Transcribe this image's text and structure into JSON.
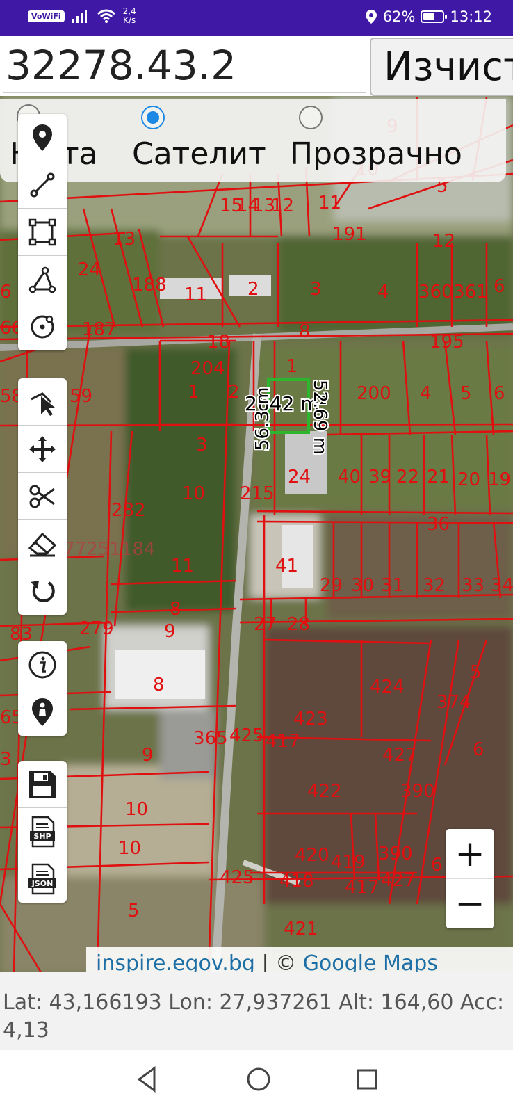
{
  "status_bar": {
    "vowifi": "VoWiFi",
    "speed_value": "2,4",
    "speed_unit": "K/s",
    "battery": "62%",
    "battery_level": 0.62,
    "time": "13:12"
  },
  "search": {
    "value": "32278.43.2"
  },
  "clear_button": {
    "label": "Изчист"
  },
  "map_type": {
    "options": [
      {
        "label": "Карта",
        "visible_text": "Н    ота",
        "selected": false
      },
      {
        "label": "Сателит",
        "selected": true
      },
      {
        "label": "Прозрачно",
        "selected": false
      }
    ]
  },
  "map": {
    "selected_parcel_area": "2642 m²",
    "edge_length_1": "56.3 m",
    "edge_length_2": "52.69 m",
    "watermark_phone": "0877251184",
    "parcel_labels": [
      "13",
      "24",
      "188",
      "11",
      "2",
      "3",
      "4",
      "360",
      "361",
      "191",
      "12",
      "14",
      "13",
      "12",
      "11",
      "15",
      "9",
      "10",
      "5",
      "187",
      "167",
      "8",
      "18",
      "195",
      "204",
      "1",
      "2",
      "200",
      "4",
      "5",
      "6",
      "58",
      "59",
      "3",
      "24",
      "40",
      "39",
      "22",
      "21",
      "20",
      "19",
      "36",
      "10",
      "215",
      "282",
      "41",
      "29",
      "30",
      "31",
      "32",
      "33",
      "34",
      "11",
      "8",
      "9",
      "83",
      "279",
      "27",
      "28",
      "8",
      "424",
      "374",
      "5",
      "423",
      "365",
      "425",
      "417",
      "6",
      "9",
      "422",
      "390",
      "10",
      "10",
      "425",
      "420",
      "419",
      "390",
      "418",
      "417",
      "427",
      "6",
      "5",
      "421",
      "66",
      "6",
      "3",
      "65"
    ]
  },
  "tools": {
    "group1": [
      "marker-icon",
      "line-icon",
      "polygon-icon",
      "path-angle-icon",
      "circle-icon"
    ],
    "group2": [
      "select-icon",
      "move-icon",
      "cut-icon",
      "eraser-icon",
      "undo-icon"
    ],
    "group3": [
      "info-icon",
      "my-location-icon"
    ],
    "group4": [
      "save-icon",
      "shp-icon",
      "json-icon"
    ],
    "shp_text": "SHP",
    "json_text": "JSON"
  },
  "zoom": {
    "plus": "+",
    "minus": "−"
  },
  "attribution": {
    "source1": "inspire.egov.bg",
    "separator": "| ©",
    "source2": "Google Maps"
  },
  "coordinates": {
    "text": "Lat: 43,166193 Lon: 27,937261 Alt: 164,60 Acc: 4,13"
  },
  "colors": {
    "status_bar": "#3f19a6",
    "parcel_lines": "#e01010",
    "selected_parcel": "#2db52d",
    "accent": "#1e88e5"
  }
}
